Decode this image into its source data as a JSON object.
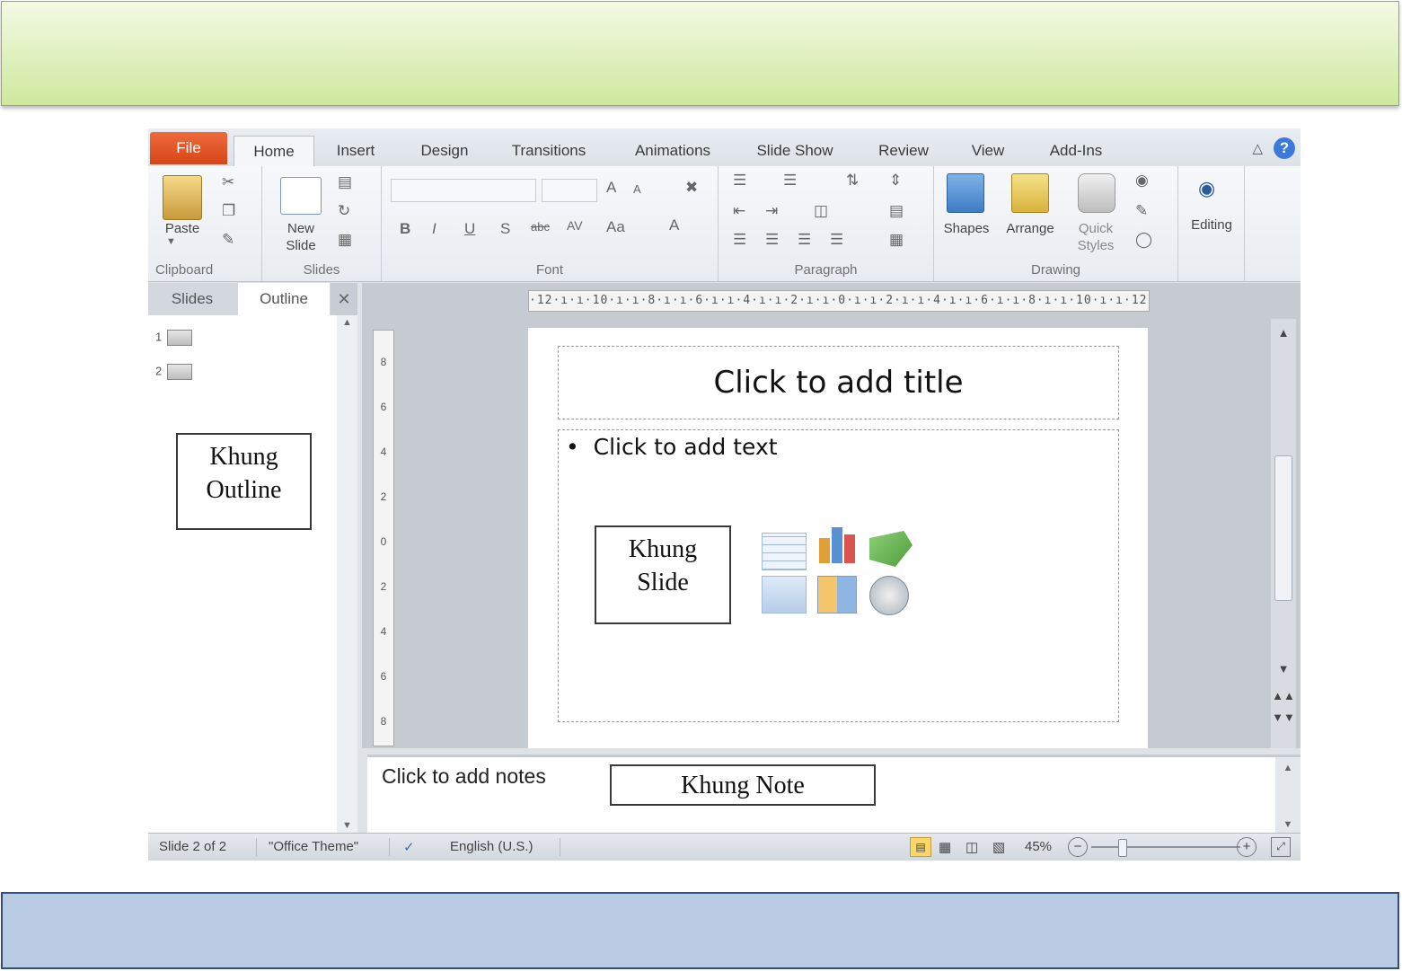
{
  "tabs": {
    "file": "File",
    "home": "Home",
    "insert": "Insert",
    "design": "Design",
    "transitions": "Transitions",
    "animations": "Animations",
    "slideshow": "Slide Show",
    "review": "Review",
    "view": "View",
    "addins": "Add-Ins"
  },
  "ribbon": {
    "paste": "Paste",
    "new_slide_1": "New",
    "new_slide_2": "Slide",
    "shapes": "Shapes",
    "arrange": "Arrange",
    "quick_styles_1": "Quick",
    "quick_styles_2": "Styles",
    "editing": "Editing",
    "groups": {
      "clipboard": "Clipboard",
      "slides": "Slides",
      "font": "Font",
      "paragraph": "Paragraph",
      "drawing": "Drawing"
    },
    "font_buttons": {
      "bold": "B",
      "italic": "I",
      "underline": "U",
      "shadow": "S",
      "strike": "abc",
      "spacing": "AV",
      "case": "Aa",
      "grow": "A",
      "shrink": "A",
      "clear": "A"
    }
  },
  "left_pane": {
    "tab_slides": "Slides",
    "tab_outline": "Outline",
    "close": "✕",
    "items": [
      {
        "num": "1"
      },
      {
        "num": "2"
      }
    ]
  },
  "callouts": {
    "outline_1": "Khung",
    "outline_2": "Outline",
    "slide_1": "Khung",
    "slide_2": "Slide",
    "note": "Khung Note"
  },
  "ruler": {
    "horizontal": "·12·ı·ı·10·ı·ı·8·ı·ı·6·ı·ı·4·ı·ı·2·ı·ı·0·ı·ı·2·ı·ı·4·ı·ı·6·ı·ı·8·ı·ı·10·ı·ı·12·",
    "vertical": [
      "8",
      "6",
      "4",
      "2",
      "0",
      "2",
      "4",
      "6",
      "8"
    ]
  },
  "slide": {
    "title_placeholder": "Click to add title",
    "content_placeholder": "Click to add text"
  },
  "notes": {
    "placeholder": "Click to add notes"
  },
  "status": {
    "slide_info": "Slide 2 of 2",
    "theme": "\"Office Theme\"",
    "language": "English (U.S.)",
    "zoom": "45%"
  },
  "colors": {
    "file_tab": "#d64518",
    "top_banner": "#cfe89d",
    "bottom_banner": "#b9cce4",
    "accent_blue": "#3b7ad9"
  }
}
